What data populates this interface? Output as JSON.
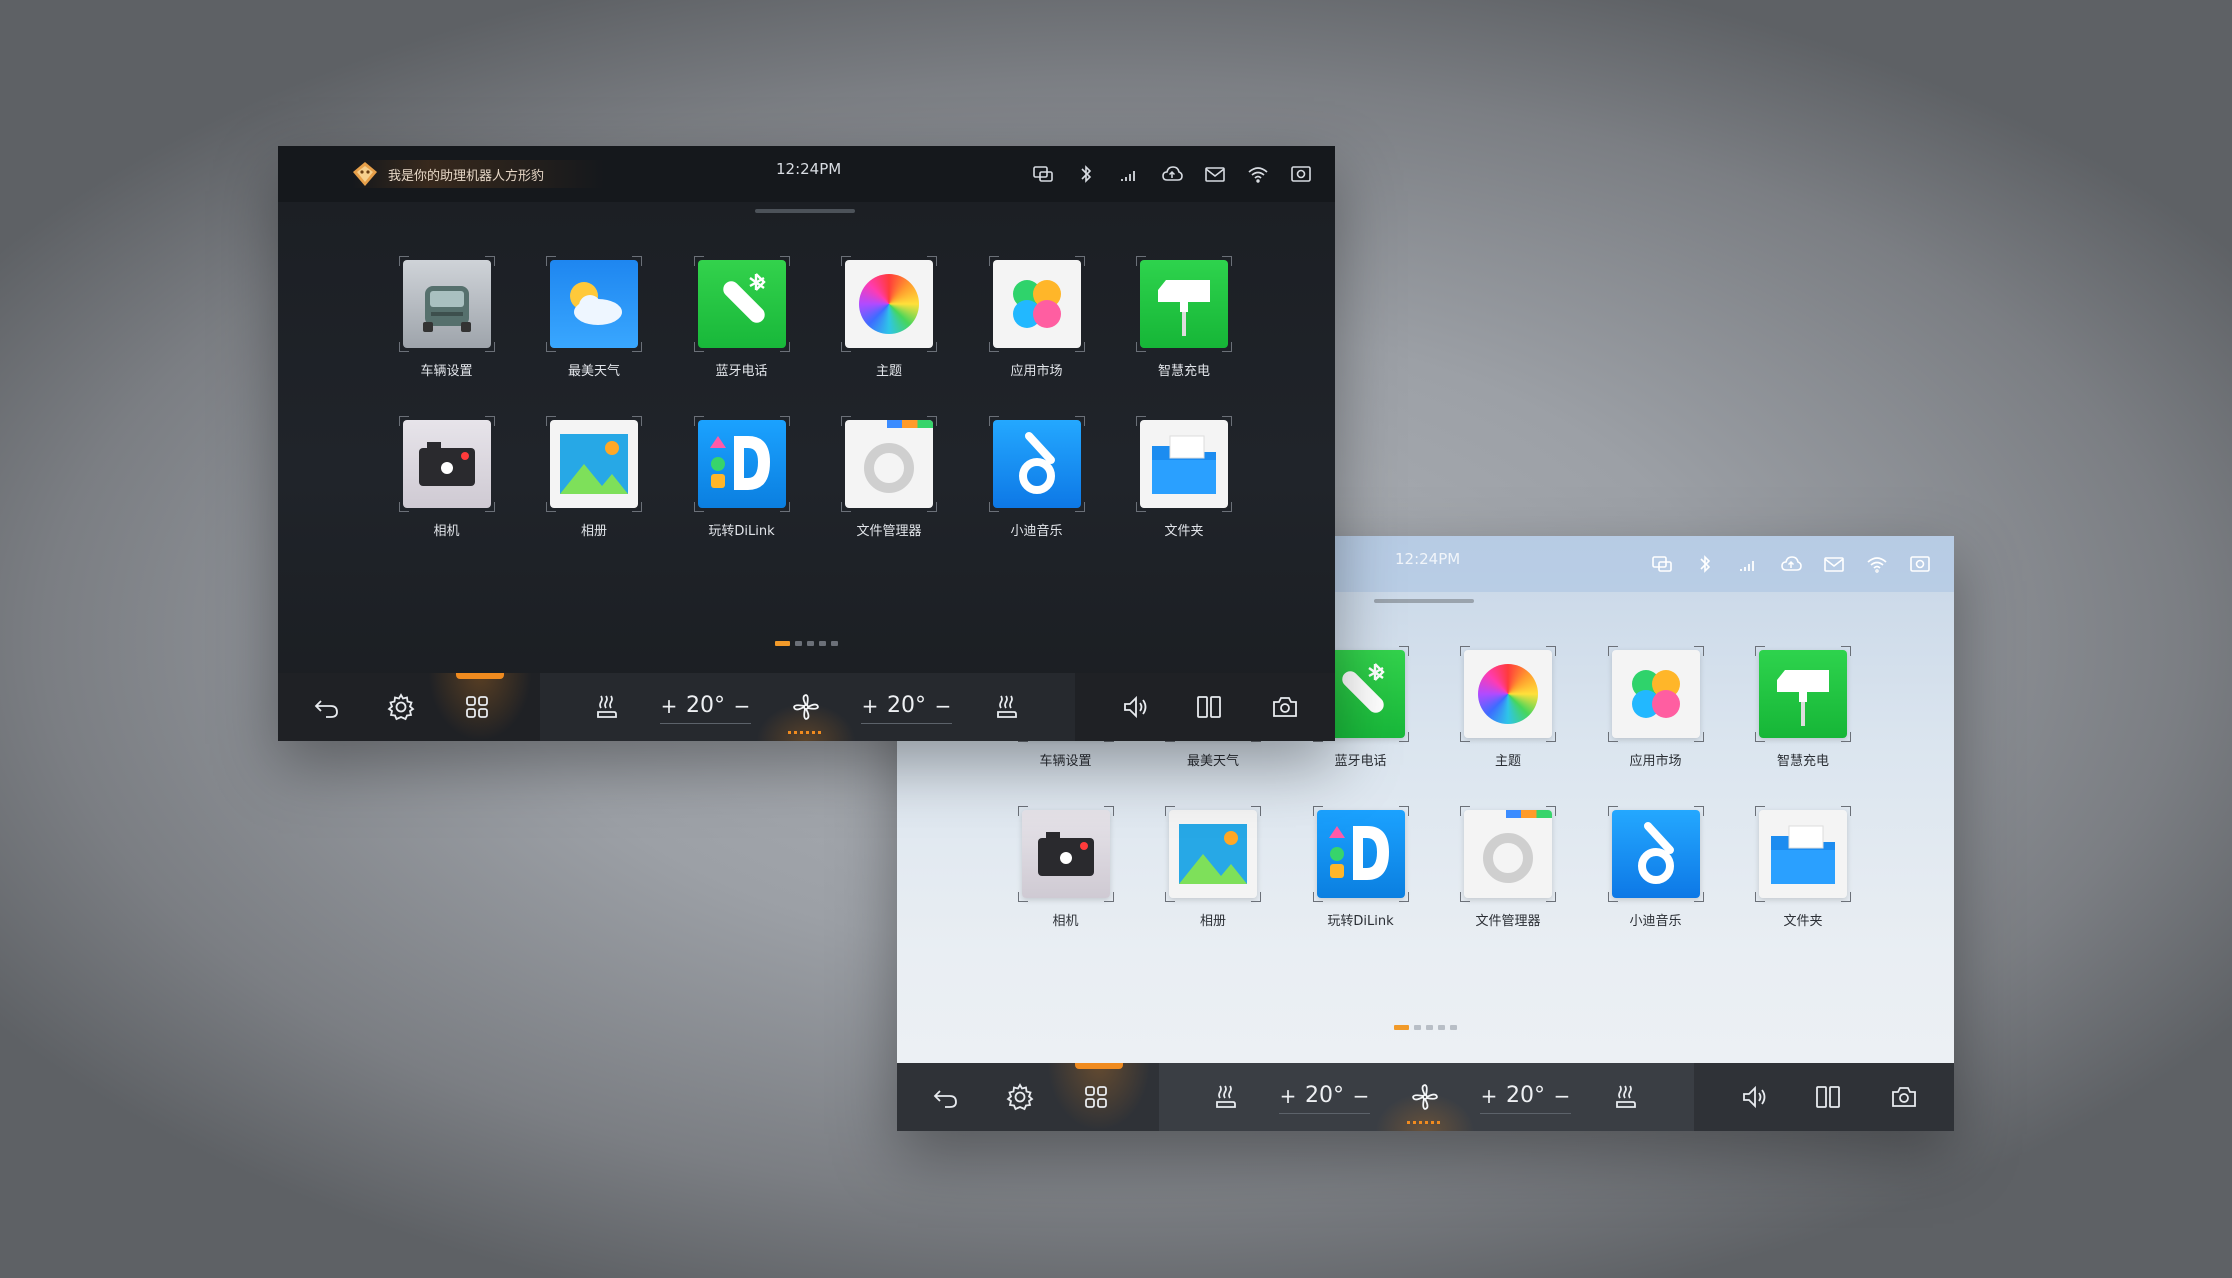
{
  "dark_screen": {
    "assistant_text": "我是你的助理机器人方形豹",
    "time": "12:24PM",
    "status_icons": [
      "screen-cast-icon",
      "bluetooth-icon",
      "signal-icon",
      "cloud-icon",
      "mail-icon",
      "wifi-icon",
      "screenshot-icon"
    ],
    "apps_row1": [
      {
        "label": "车辆设置",
        "icon": "vehicle-settings-icon"
      },
      {
        "label": "最美天气",
        "icon": "weather-icon"
      },
      {
        "label": "蓝牙电话",
        "icon": "bluetooth-phone-icon"
      },
      {
        "label": "主题",
        "icon": "theme-icon"
      },
      {
        "label": "应用市场",
        "icon": "app-market-icon"
      },
      {
        "label": "智慧充电",
        "icon": "smart-charging-icon"
      }
    ],
    "apps_row2": [
      {
        "label": "相机",
        "icon": "camera-app-icon"
      },
      {
        "label": "相册",
        "icon": "gallery-icon"
      },
      {
        "label": "玩转DiLink",
        "icon": "dilink-icon"
      },
      {
        "label": "文件管理器",
        "icon": "file-manager-icon"
      },
      {
        "label": "小迪音乐",
        "icon": "music-icon"
      },
      {
        "label": "文件夹",
        "icon": "folder-icon"
      }
    ],
    "page_count": 5,
    "active_page": 1,
    "dock": {
      "left_temp": "20°",
      "right_temp": "20°",
      "plus": "+",
      "minus": "−"
    }
  },
  "light_screen": {
    "time": "12:24PM",
    "status_icons": [
      "screen-cast-icon",
      "bluetooth-icon",
      "signal-icon",
      "cloud-icon",
      "mail-icon",
      "wifi-icon",
      "screenshot-icon"
    ],
    "apps_row1": [
      {
        "label": "车辆设置",
        "icon": "vehicle-settings-icon"
      },
      {
        "label": "最美天气",
        "icon": "weather-icon"
      },
      {
        "label": "蓝牙电话",
        "icon": "bluetooth-phone-icon"
      },
      {
        "label": "主题",
        "icon": "theme-icon"
      },
      {
        "label": "应用市场",
        "icon": "app-market-icon"
      },
      {
        "label": "智慧充电",
        "icon": "smart-charging-icon"
      }
    ],
    "apps_row2": [
      {
        "label": "相机",
        "icon": "camera-app-icon"
      },
      {
        "label": "相册",
        "icon": "gallery-icon"
      },
      {
        "label": "玩转DiLink",
        "icon": "dilink-icon"
      },
      {
        "label": "文件管理器",
        "icon": "file-manager-icon"
      },
      {
        "label": "小迪音乐",
        "icon": "music-icon"
      },
      {
        "label": "文件夹",
        "icon": "folder-icon"
      }
    ],
    "page_count": 5,
    "active_page": 1,
    "dock": {
      "left_temp": "20°",
      "right_temp": "20°",
      "plus": "+",
      "minus": "−"
    }
  },
  "colors": {
    "accent": "#f19a2a",
    "dark_bg": "#1d2025",
    "light_bg": "#dbe5ef",
    "dock_bg": "#2b2f34"
  }
}
